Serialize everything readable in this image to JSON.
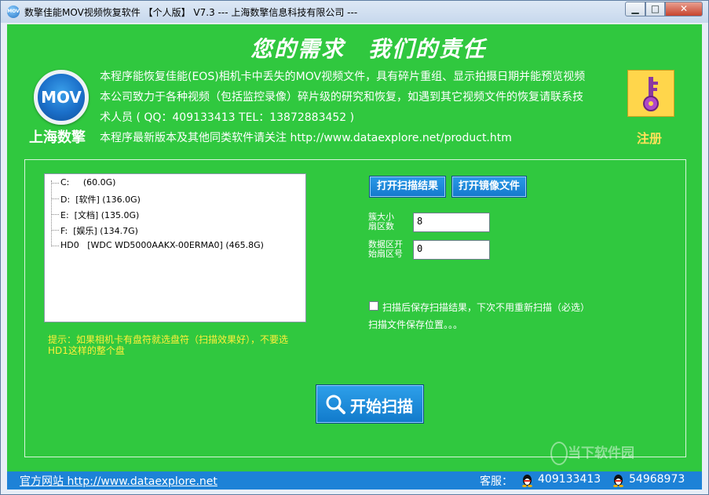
{
  "window": {
    "title": "数擎佳能MOV视频恢复软件 【个人版】 V7.3 --- 上海数擎信息科技有限公司 ---",
    "icon_text": "MOV",
    "controls": {
      "minimize": "▁",
      "maximize": "□",
      "close": "✕"
    }
  },
  "header": {
    "slogan": "您的需求　我们的责任",
    "logo_text": "MOV",
    "company": "上海数擎",
    "desc_lines": [
      "本程序能恢复佳能(EOS)相机卡中丢失的MOV视频文件，具有碎片重组、显示拍摄日期并能预览视频",
      "本公司致力于各种视频（包括监控录像）碎片级的研究和恢复，如遇到其它视频文件的恢复请联系技",
      "术人员 ( QQ：409133413  TEL：13872883452 )",
      "本程序最新版本及其他同类软件请关注 http://www.dataexplore.net/product.htm"
    ],
    "register_label": "注册",
    "register_icon": "key-icon"
  },
  "drives": [
    {
      "letter": "C:",
      "label": "",
      "size": "(60.0G)"
    },
    {
      "letter": "D:",
      "label": "[软件]",
      "size": "(136.0G)"
    },
    {
      "letter": "E:",
      "label": "[文档]",
      "size": "(135.0G)"
    },
    {
      "letter": "F:",
      "label": "[娱乐]",
      "size": "(134.7G)"
    },
    {
      "letter": "HD0",
      "label": "[WDC WD5000AAKX-00ERMA0]",
      "size": "(465.8G)"
    }
  ],
  "hint": "提示：如果相机卡有盘符就选盘符（扫描效果好），不要选HD1这样的整个盘",
  "buttons": {
    "open_scan_result": "打开扫描结果",
    "open_image_file": "打开镜像文件",
    "start_scan": "开始扫描"
  },
  "fields": {
    "max_sectors_label_1": "簇大小",
    "max_sectors_label_2": "扇区数",
    "max_sectors_value": "8",
    "start_sector_label_1": "数据区开",
    "start_sector_label_2": "始扇区号",
    "start_sector_value": "0"
  },
  "options": {
    "save_scan_result": "扫描后保存扫描结果，下次不用重新扫描（必选）",
    "save_location": "扫描文件保存位置。。。"
  },
  "footer": {
    "site": "官方网站 http://www.dataexplore.net",
    "service_label": "客服：",
    "qq1": "409133413",
    "qq2": "54968973"
  },
  "watermark": "当下软件园",
  "colors": {
    "background": "#30c83f",
    "footer": "#1d82d7",
    "accent": "#ffe15a"
  }
}
